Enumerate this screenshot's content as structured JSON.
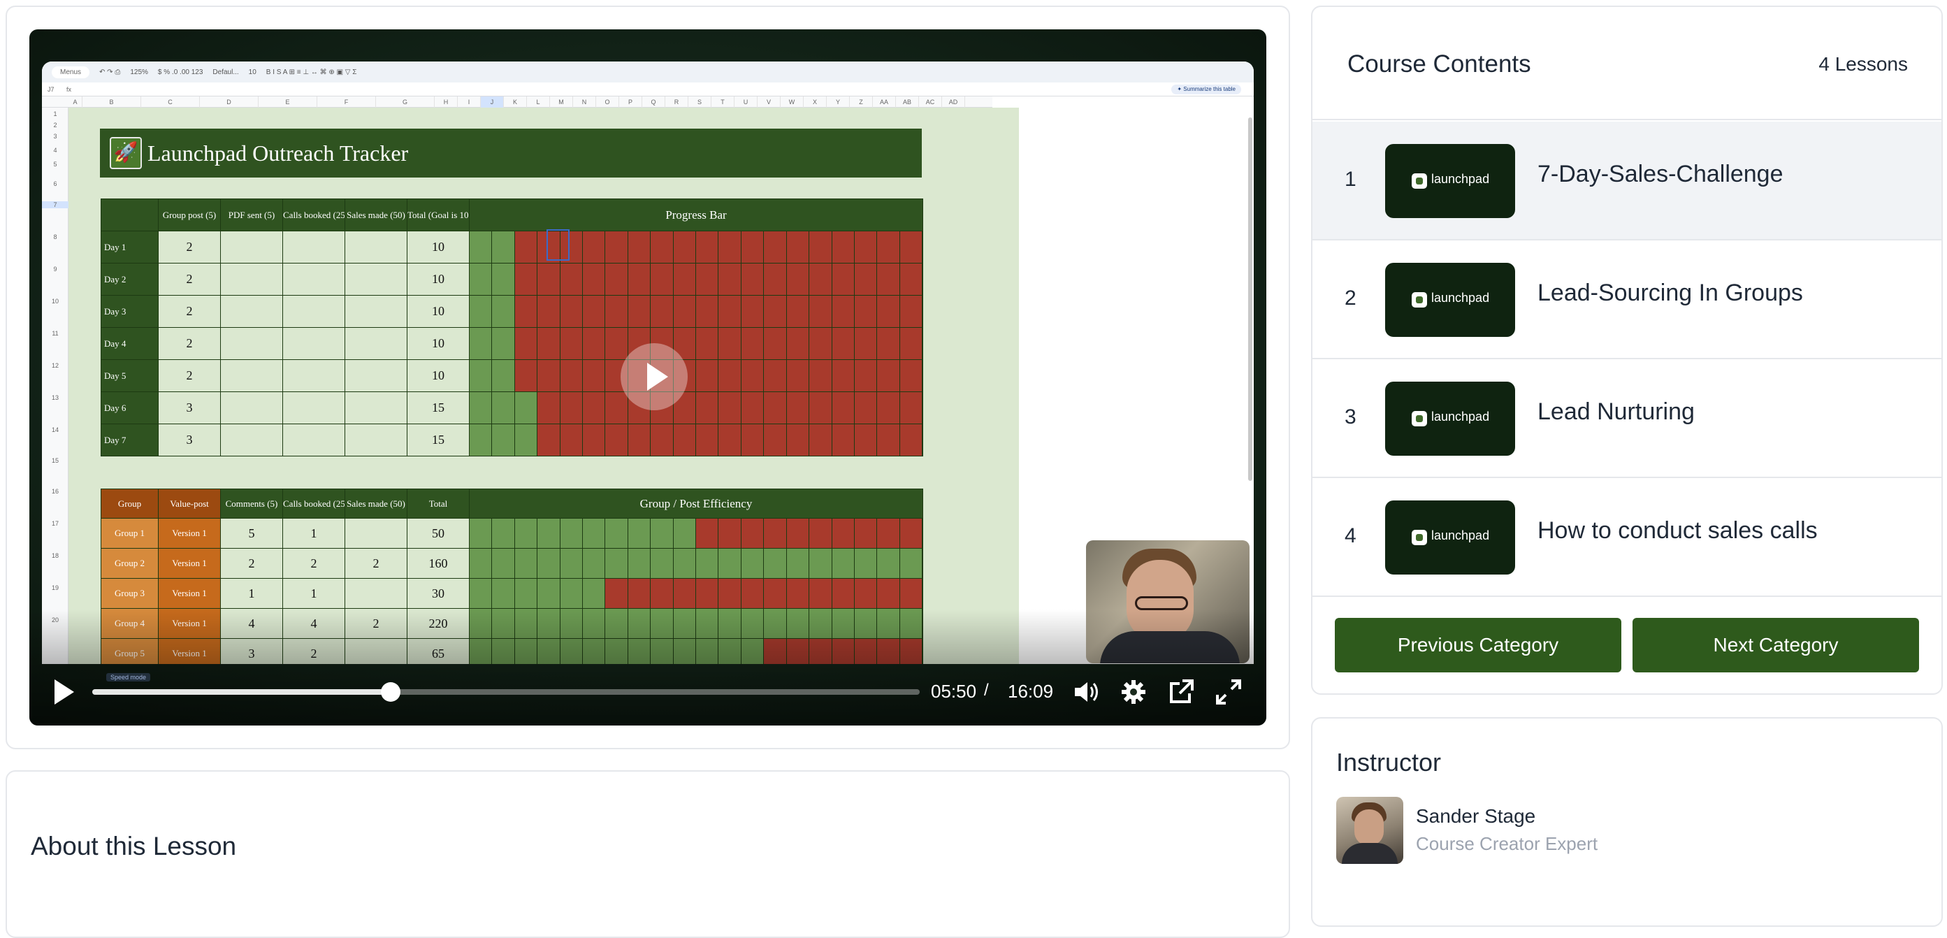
{
  "video": {
    "current_time": "05:50",
    "separator": "/",
    "duration": "16:09",
    "progress_fraction": 0.361,
    "speed_mode_label": "Speed mode"
  },
  "spreadsheet": {
    "toolbar": {
      "menus": "Menus",
      "zoom": "125%",
      "font": "Defaul...",
      "font_size": "10"
    },
    "cell_ref": "J7",
    "fx": "fx",
    "summarize_label": "✦ Summarize this table",
    "columns": [
      "A",
      "B",
      "C",
      "D",
      "E",
      "F",
      "G",
      "H",
      "I",
      "J",
      "K",
      "L",
      "M",
      "N",
      "O",
      "P",
      "Q",
      "R",
      "S",
      "T",
      "U",
      "V",
      "W",
      "X",
      "Y",
      "Z",
      "AA",
      "AB",
      "AC",
      "AD"
    ],
    "rows": [
      "1",
      "2",
      "3",
      "4",
      "5",
      "6",
      "7",
      "8",
      "9",
      "10",
      "11",
      "12",
      "13",
      "14",
      "15",
      "16",
      "17",
      "18",
      "19",
      "20"
    ],
    "title": "Launchpad Outreach Tracker",
    "progress_table": {
      "headers": [
        "",
        "Group post (5)",
        "PDF sent (5)",
        "Calls booked (25)",
        "Sales made (50)",
        "Total (Goal is 100)",
        "Progress Bar"
      ],
      "rows": [
        {
          "day": "Day 1",
          "group_post": "2",
          "pdf": "",
          "calls": "",
          "sales": "",
          "total": "10",
          "green": 2
        },
        {
          "day": "Day 2",
          "group_post": "2",
          "pdf": "",
          "calls": "",
          "sales": "",
          "total": "10",
          "green": 2
        },
        {
          "day": "Day 3",
          "group_post": "2",
          "pdf": "",
          "calls": "",
          "sales": "",
          "total": "10",
          "green": 2
        },
        {
          "day": "Day 4",
          "group_post": "2",
          "pdf": "",
          "calls": "",
          "sales": "",
          "total": "10",
          "green": 2
        },
        {
          "day": "Day 5",
          "group_post": "2",
          "pdf": "",
          "calls": "",
          "sales": "",
          "total": "10",
          "green": 2
        },
        {
          "day": "Day 6",
          "group_post": "3",
          "pdf": "",
          "calls": "",
          "sales": "",
          "total": "15",
          "green": 3
        },
        {
          "day": "Day 7",
          "group_post": "3",
          "pdf": "",
          "calls": "",
          "sales": "",
          "total": "15",
          "green": 3
        }
      ],
      "bar_cells": 20
    },
    "efficiency_table": {
      "headers": [
        "Group",
        "Value-post",
        "Comments (5)",
        "Calls booked (25)",
        "Sales made (50)",
        "Total",
        "Group / Post Efficiency"
      ],
      "rows": [
        {
          "group": "Group 1",
          "version": "Version 1",
          "comments": "5",
          "calls": "1",
          "sales": "",
          "total": "50",
          "green": 10
        },
        {
          "group": "Group 2",
          "version": "Version 1",
          "comments": "2",
          "calls": "2",
          "sales": "2",
          "total": "160",
          "green": 20
        },
        {
          "group": "Group 3",
          "version": "Version 1",
          "comments": "1",
          "calls": "1",
          "sales": "",
          "total": "30",
          "green": 6
        },
        {
          "group": "Group 4",
          "version": "Version 1",
          "comments": "4",
          "calls": "4",
          "sales": "2",
          "total": "220",
          "green": 20
        },
        {
          "group": "Group 5",
          "version": "Version 1",
          "comments": "3",
          "calls": "2",
          "sales": "",
          "total": "65",
          "green": 13
        }
      ],
      "bar_cells": 20
    },
    "colors": {
      "green": "#6b9a52",
      "red": "#a83a2c",
      "dark_green": "#2f5320"
    }
  },
  "about": {
    "title": "About this Lesson"
  },
  "contents": {
    "title": "Course Contents",
    "count": "4 Lessons",
    "lessons": [
      {
        "num": "1",
        "title": "7-Day-Sales-Challenge",
        "thumb_text": "launchpad"
      },
      {
        "num": "2",
        "title": "Lead-Sourcing In Groups",
        "thumb_text": "launchpad"
      },
      {
        "num": "3",
        "title": "Lead Nurturing",
        "thumb_text": "launchpad"
      },
      {
        "num": "4",
        "title": "How to conduct sales calls",
        "thumb_text": "launchpad"
      }
    ],
    "prev_label": "Previous Category",
    "next_label": "Next Category"
  },
  "instructor": {
    "title": "Instructor",
    "name": "Sander Stage",
    "role": "Course Creator Expert"
  }
}
